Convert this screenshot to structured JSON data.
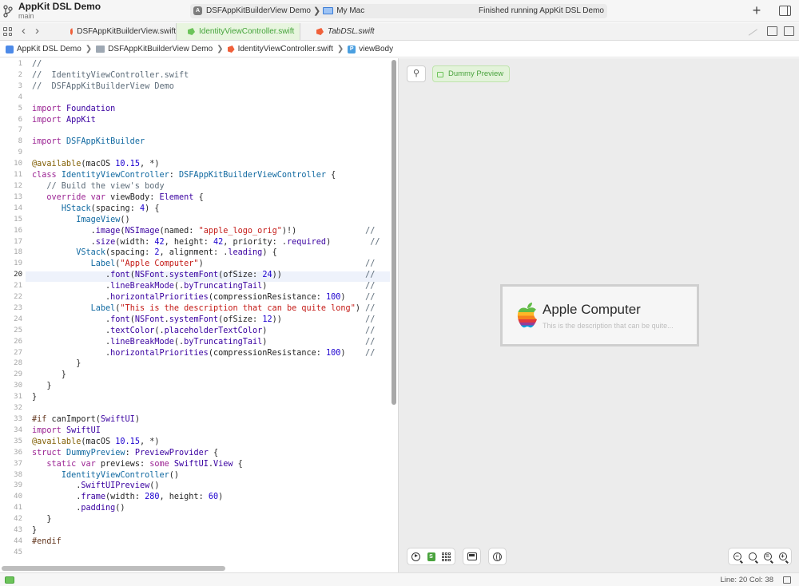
{
  "titlebar": {
    "project_name": "AppKit DSL Demo",
    "branch": "main",
    "scheme": "DSFAppKitBuilderView Demo",
    "scheme_separator": "❯",
    "destination": "My Mac",
    "status": "Finished running AppKit DSL Demo",
    "add_icon": "plus-icon",
    "inspector_icon": "sidebar-right-icon"
  },
  "tabs": [
    {
      "label": "DSFAppKitBuilderView.swift",
      "state": "normal"
    },
    {
      "label": "IdentityViewController.swift",
      "state": "active"
    },
    {
      "label": "TabDSL.swift",
      "state": "preview"
    }
  ],
  "nav": {
    "back": "‹",
    "forward": "›"
  },
  "breadcrumb": {
    "items": [
      "AppKit DSL Demo",
      "DSFAppKitBuilderView Demo",
      "IdentityViewController.swift",
      "viewBody"
    ],
    "separator": "❯",
    "property_badge": "P"
  },
  "editor": {
    "current_line": 20,
    "lines": [
      "//",
      "//  IdentityViewController.swift",
      "//  DSFAppKitBuilderView Demo",
      "",
      "import Foundation",
      "import AppKit",
      "",
      "import DSFAppKitBuilder",
      "",
      "@available(macOS 10.15, *)",
      "class IdentityViewController: DSFAppKitBuilderViewController {",
      "   // Build the view's body",
      "   override var viewBody: Element {",
      "      HStack(spacing: 4) {",
      "         ImageView()",
      "            .image(NSImage(named: \"apple_logo_orig\")!)              //",
      "            .size(width: 42, height: 42, priority: .required)        //",
      "         VStack(spacing: 2, alignment: .leading) {",
      "            Label(\"Apple Computer\")                                 //",
      "               .font(NSFont.systemFont(ofSize: 24))                 //",
      "               .lineBreakMode(.byTruncatingTail)                    //",
      "               .horizontalPriorities(compressionResistance: 100)    //",
      "            Label(\"This is the description that can be quite long\") //",
      "               .font(NSFont.systemFont(ofSize: 12))                 //",
      "               .textColor(.placeholderTextColor)                    //",
      "               .lineBreakMode(.byTruncatingTail)                    //",
      "               .horizontalPriorities(compressionResistance: 100)    //",
      "         }",
      "      }",
      "   }",
      "}",
      "",
      "#if canImport(SwiftUI)",
      "import SwiftUI",
      "@available(macOS 10.15, *)",
      "struct DummyPreview: PreviewProvider {",
      "   static var previews: some SwiftUI.View {",
      "      IdentityViewController()",
      "         .SwiftUIPreview()",
      "         .frame(width: 280, height: 60)",
      "         .padding()",
      "   }",
      "}",
      "#endif",
      ""
    ]
  },
  "preview": {
    "pin_icon": "pin-icon",
    "chip_label": "Dummy Preview",
    "title": "Apple Computer",
    "description": "This is the description that can be quite...",
    "live_badge": "S"
  },
  "status": {
    "cursor": "Line: 20  Col: 38"
  },
  "colors": {
    "keyword": "#9b2393",
    "type": "#3900a0",
    "project_type": "#0f68a0",
    "string": "#c41a16",
    "number": "#1c00cf",
    "comment": "#5d6c79",
    "attribute": "#815f03",
    "directive": "#643820",
    "accent_green": "#4aa33e"
  }
}
